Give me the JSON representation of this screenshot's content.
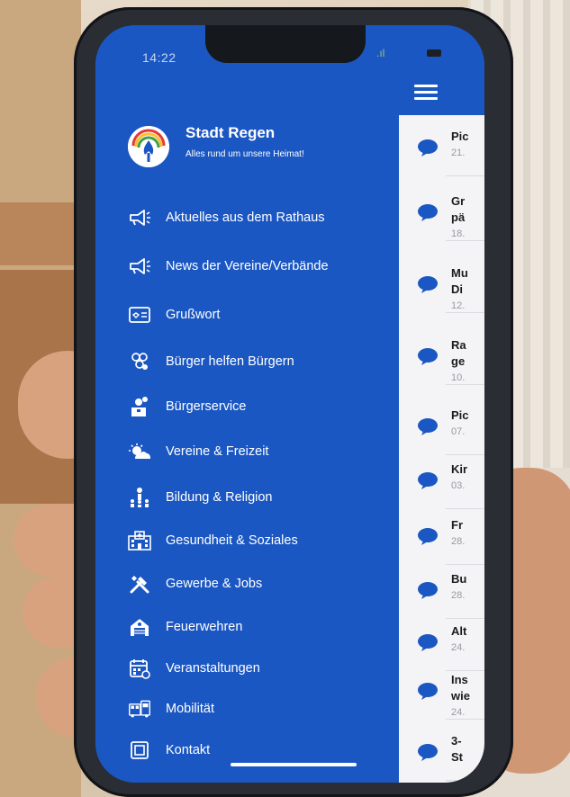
{
  "status_bar": {
    "time": "14:22"
  },
  "app": {
    "title": "Stadt Regen",
    "subtitle": "Alles rund um unsere Heimat!"
  },
  "menu": [
    {
      "label": "Aktuelles aus dem Rathaus",
      "icon": "megaphone-icon"
    },
    {
      "label": "News der Vereine/Verbände",
      "icon": "megaphone-icon"
    },
    {
      "label": "Grußwort",
      "icon": "id-card-icon"
    },
    {
      "label": "Bürger helfen Bürgern",
      "icon": "people-group-icon"
    },
    {
      "label": "Bürgerservice",
      "icon": "service-person-icon"
    },
    {
      "label": "Vereine & Freizeit",
      "icon": "sun-cloud-icon"
    },
    {
      "label": "Bildung & Religion",
      "icon": "teacher-class-icon"
    },
    {
      "label": "Gesundheit & Soziales",
      "icon": "hospital-icon"
    },
    {
      "label": "Gewerbe & Jobs",
      "icon": "tools-icon"
    },
    {
      "label": "Feuerwehren",
      "icon": "fire-station-icon"
    },
    {
      "label": "Veranstaltungen",
      "icon": "calendar-icon"
    },
    {
      "label": "Mobilität",
      "icon": "bus-icon"
    },
    {
      "label": "Kontakt",
      "icon": "contact-icon"
    }
  ],
  "news": [
    {
      "line1": "Pic",
      "line2": "",
      "date": "21."
    },
    {
      "line1": "Gr",
      "line2": "pä",
      "date": "18."
    },
    {
      "line1": "Mu",
      "line2": "Di",
      "date": "12."
    },
    {
      "line1": "Ra",
      "line2": "ge",
      "date": "10."
    },
    {
      "line1": "Pic",
      "line2": "",
      "date": "07."
    },
    {
      "line1": "Kir",
      "line2": "",
      "date": "03."
    },
    {
      "line1": "Fr",
      "line2": "",
      "date": "28."
    },
    {
      "line1": "Bu",
      "line2": "",
      "date": "28."
    },
    {
      "line1": "Alt",
      "line2": "",
      "date": "24."
    },
    {
      "line1": "Ins",
      "line2": "wie",
      "date": "24."
    },
    {
      "line1": "3-",
      "line2": "St",
      "date": ""
    }
  ],
  "colors": {
    "drawer": "#1b57c2",
    "content": "#f4f4f6",
    "bubble": "#1b57c2"
  }
}
